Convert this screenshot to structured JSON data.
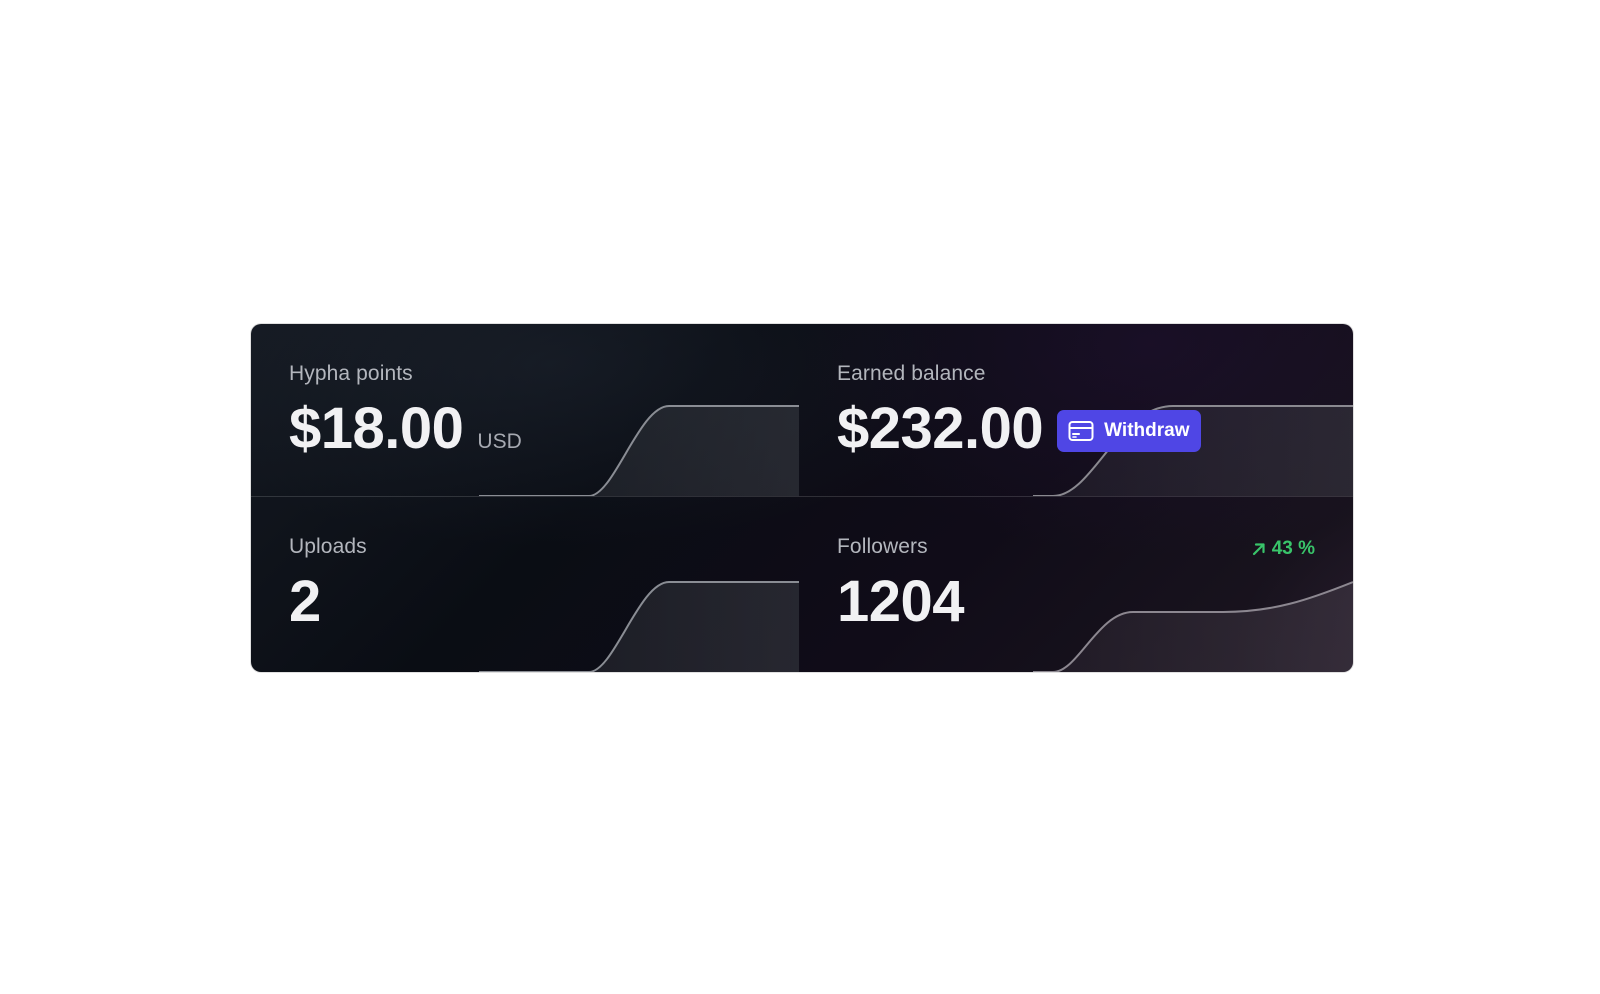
{
  "stats": {
    "hypha_points": {
      "label": "Hypha points",
      "value": "$18.00",
      "unit": "USD"
    },
    "earned_balance": {
      "label": "Earned balance",
      "value": "$232.00",
      "withdraw_label": "Withdraw",
      "withdraw_icon": "credit-card-icon"
    },
    "uploads": {
      "label": "Uploads",
      "value": "2"
    },
    "followers": {
      "label": "Followers",
      "value": "1204",
      "trend": "43 %",
      "trend_icon": "arrow-up-right-icon",
      "trend_color": "#39c46a"
    }
  },
  "colors": {
    "card_background": "#0b0e15",
    "accent": "#4f46e5",
    "text_primary": "#f1f1f3",
    "text_secondary": "#b3b6bd",
    "positive": "#39c46a"
  }
}
